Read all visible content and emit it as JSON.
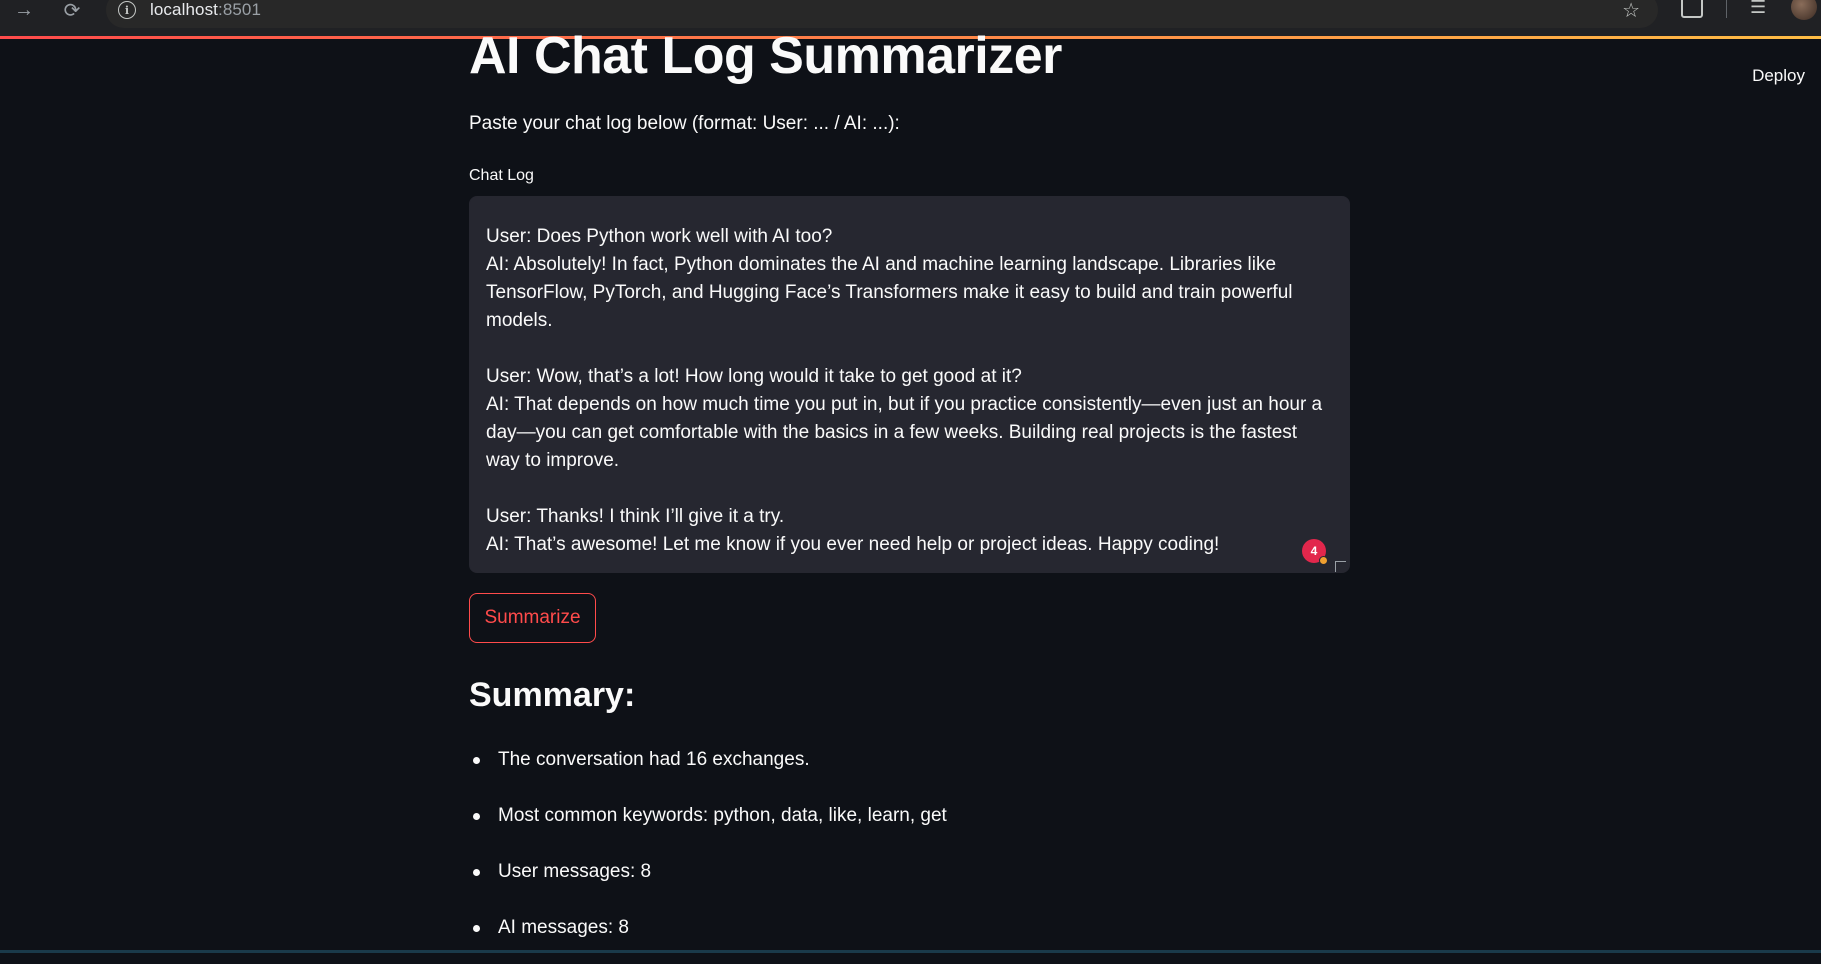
{
  "browser": {
    "url_host": "localhost",
    "url_port": ":8501"
  },
  "header": {
    "deploy_label": "Deploy"
  },
  "main": {
    "title": "AI Chat Log Summarizer",
    "instructions": "Paste your chat log below (format: User: ... / AI: ...):",
    "textarea_label": "Chat Log",
    "textarea_value": "User: Does Python work well with AI too?\nAI: Absolutely! In fact, Python dominates the AI and machine learning landscape. Libraries like TensorFlow, PyTorch, and Hugging Face’s Transformers make it easy to build and train powerful models.\n\nUser: Wow, that’s a lot! How long would it take to get good at it?\nAI: That depends on how much time you put in, but if you practice consistently—even just an hour a day—you can get comfortable with the basics in a few weeks. Building real projects is the fastest way to improve.\n\nUser: Thanks! I think I’ll give it a try.\nAI: That’s awesome! Let me know if you ever need help or project ideas. Happy coding!",
    "grammarly_count": "4",
    "summarize_label": "Summarize",
    "summary_heading": "Summary:",
    "summary_items": [
      "The conversation had 16 exchanges.",
      "Most common keywords: python, data, like, learn, get",
      "User messages: 8",
      "AI messages: 8"
    ]
  },
  "colors": {
    "background": "#0e1117",
    "accent": "#ff4b4b",
    "textarea_bg": "#262730"
  },
  "icons": [
    "forward-arrow-icon",
    "reload-icon",
    "info-icon",
    "star-icon",
    "extensions-icon",
    "media-icon",
    "profile-avatar"
  ]
}
